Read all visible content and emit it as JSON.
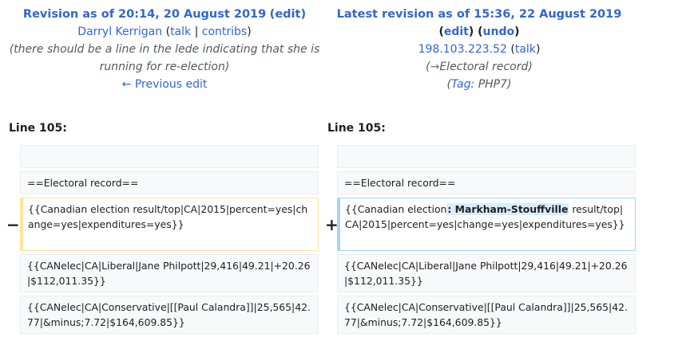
{
  "left": {
    "revision_title": "Revision as of 20:14, 20 August 2019",
    "edit_link": "edit",
    "user": "Darryl Kerrigan",
    "talk": "talk",
    "contribs": "contribs",
    "summary_line1": "(there should be a line in the lede indicating that she is",
    "summary_line2": "running for re-election)",
    "previous_edit": "← Previous edit",
    "line_number": "Line 105:"
  },
  "right": {
    "revision_title": "Latest revision as of 15:36, 22 August 2019",
    "edit_link": "edit",
    "undo_link": "undo",
    "ip": "198.103.223.52",
    "talk": "talk",
    "section_arrow": "→",
    "section": "Electoral record",
    "tag_label": "Tag:",
    "tag": "PHP7",
    "line_number": "Line 105:"
  },
  "diff": {
    "deleted_marker": "−",
    "added_marker": "+",
    "context_1": "==Electoral record==",
    "deleted_line": "{{Canadian election result/top|CA|2015|percent=yes|change=yes|expenditures=yes}}",
    "added_prefix": "{{Canadian election",
    "added_inserted": ": Markham-Stouffville",
    "added_suffix": " result/top|CA|2015|percent=yes|change=yes|expenditures=yes}}",
    "context_2": "{{CANelec|CA|Liberal|Jane Philpott|29,416|49.21|+20.26|$112,011.35}}",
    "context_3": "{{CANelec|CA|Conservative|[[Paul Calandra]]|25,565|42.77|&minus;7.72|$164,609.85}}"
  }
}
